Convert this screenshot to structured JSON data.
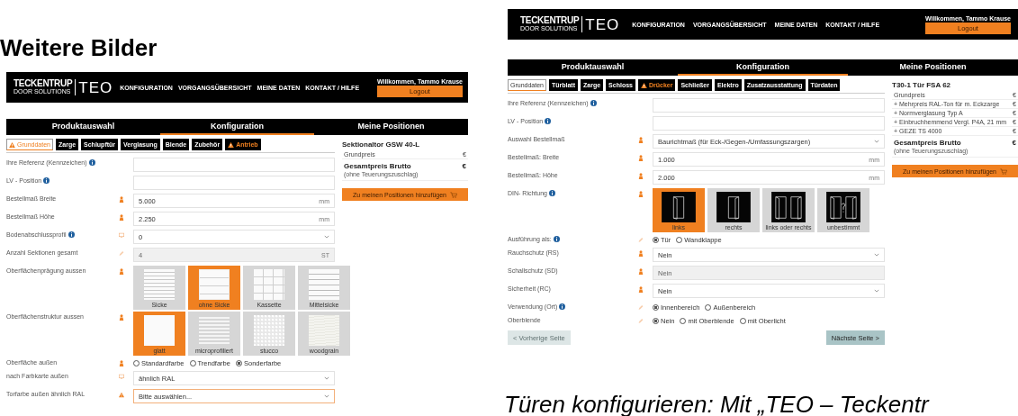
{
  "heading": "Weitere Bilder",
  "shots": [
    {
      "header": {
        "brand": "TECKENTRUP",
        "brand_sub": "DOOR SOLUTIONS",
        "product": "TEO",
        "nav": [
          "KONFIGURATION",
          "VORGANGSÜBERSICHT",
          "MEINE DATEN",
          "KONTAKT / HILFE"
        ],
        "welcome": "Willkommen, Tammo Krause",
        "logout": "Logout"
      },
      "steps": [
        {
          "label": "Produktauswahl",
          "selected": false
        },
        {
          "label": "Konfiguration",
          "selected": true
        },
        {
          "label": "Meine Positionen",
          "selected": false
        }
      ],
      "tabs": [
        {
          "label": "Grunddaten",
          "selected": true,
          "warning": true
        },
        {
          "label": "Zarge",
          "selected": false,
          "warning": false
        },
        {
          "label": "Schlupftür",
          "selected": false,
          "warning": false
        },
        {
          "label": "Verglasung",
          "selected": false,
          "warning": false
        },
        {
          "label": "Blende",
          "selected": false,
          "warning": false
        },
        {
          "label": "Zubehör",
          "selected": false,
          "warning": false
        },
        {
          "label": "Antrieb",
          "selected": false,
          "warning": true
        }
      ],
      "rows": [
        {
          "kind": "input",
          "label": "Ihre Referenz (Kennzeichen)",
          "info": true
        },
        {
          "kind": "input",
          "label": "LV - Position",
          "info": true
        },
        {
          "kind": "input",
          "label": "Bestellmaß Breite",
          "required": true,
          "value": "5.000",
          "unit": "mm"
        },
        {
          "kind": "input",
          "label": "Bestellmaß Höhe",
          "required": true,
          "value": "2.250",
          "unit": "mm"
        },
        {
          "kind": "select",
          "label": "Bodenabschlussprofil",
          "info": true,
          "screen_hint": true,
          "value": "0"
        },
        {
          "kind": "input",
          "label": "Anzahl Sektionen gesamt",
          "editable": true,
          "value": "4",
          "unit": "ST",
          "disabled": true
        },
        {
          "kind": "tiles",
          "label": "Oberflächenprägung aussen",
          "required": true,
          "tiles": [
            {
              "label": "Sicke",
              "kind": "lines",
              "selected": false
            },
            {
              "label": "ohne Sicke",
              "kind": "sections",
              "selected": true
            },
            {
              "label": "Kassette",
              "kind": "grid",
              "selected": false
            },
            {
              "label": "Mittelsicke",
              "kind": "wide",
              "selected": false
            }
          ]
        },
        {
          "kind": "tiles",
          "label": "Oberflächenstruktur aussen",
          "required": true,
          "tiles": [
            {
              "label": "glatt",
              "kind": "plain",
              "selected": true
            },
            {
              "label": "microprofiliert",
              "kind": "stripes",
              "selected": false
            },
            {
              "label": "stucco",
              "kind": "texture",
              "selected": false
            },
            {
              "label": "woodgrain",
              "kind": "wood",
              "selected": false
            }
          ]
        },
        {
          "kind": "radio",
          "label": "Oberfläche außen",
          "required": true,
          "options": [
            {
              "label": "Standardfarbe",
              "selected": false
            },
            {
              "label": "Trendfarbe",
              "selected": false
            },
            {
              "label": "Sonderfarbe",
              "selected": true
            }
          ]
        },
        {
          "kind": "select",
          "label": "nach Farbkarte außen",
          "screen_hint": true,
          "value": "ähnlich RAL"
        },
        {
          "kind": "select",
          "label": "Torfarbe außen ähnlich RAL",
          "error": true,
          "value": "Bitte auswählen...",
          "invalid": true
        }
      ],
      "panel": {
        "title": "Sektionaltor GSW 40-L",
        "lines": [
          {
            "label": "Grundpreis",
            "price": "€"
          }
        ],
        "total": "Gesamtpreis Brutto",
        "total_price": "€",
        "total_note": "(ohne Teuerungszuschlag)",
        "button": "Zu meinen Positionen hinzufügen"
      }
    },
    {
      "header": {
        "brand": "TECKENTRUP",
        "brand_sub": "DOOR SOLUTIONS",
        "product": "TEO",
        "nav": [
          "KONFIGURATION",
          "VORGANGSÜBERSICHT",
          "MEINE DATEN",
          "KONTAKT / HILFE"
        ],
        "welcome": "Willkommen, Tammo Krause",
        "logout": "Logout"
      },
      "steps": [
        {
          "label": "Produktauswahl",
          "selected": false
        },
        {
          "label": "Konfiguration",
          "selected": true
        },
        {
          "label": "Meine Positionen",
          "selected": false
        }
      ],
      "tabs": [
        {
          "label": "Grunddaten",
          "selected": true,
          "warning": false
        },
        {
          "label": "Türblatt",
          "selected": false,
          "warning": false
        },
        {
          "label": "Zarge",
          "selected": false,
          "warning": false
        },
        {
          "label": "Schloss",
          "selected": false,
          "warning": false
        },
        {
          "label": "Drücker",
          "selected": false,
          "warning": true
        },
        {
          "label": "Schließer",
          "selected": false,
          "warning": false
        },
        {
          "label": "Elektro",
          "selected": false,
          "warning": false
        },
        {
          "label": "Zusatzausstattung",
          "selected": false,
          "warning": false
        },
        {
          "label": "Türdaten",
          "selected": false,
          "warning": false
        }
      ],
      "rows": [
        {
          "kind": "input",
          "label": "Ihre Referenz (Kennzeichen)",
          "info": true
        },
        {
          "kind": "input",
          "label": "LV - Position",
          "info": true
        },
        {
          "kind": "select",
          "label": "Auswahl Bestellmaß",
          "required": true,
          "value": "Baurichtmaß (für Eck-/Gegen-/Umfassungszargen)"
        },
        {
          "kind": "input",
          "label": "Bestellmaß: Breite",
          "required": true,
          "value": "1.000",
          "unit": "mm"
        },
        {
          "kind": "input",
          "label": "Bestellmaß: Höhe",
          "required": true,
          "value": "2.000",
          "unit": "mm"
        },
        {
          "kind": "tiles",
          "label": "DIN- Richtung",
          "info": true,
          "required": true,
          "tiles": [
            {
              "label": "links",
              "kind": "door-left",
              "selected": true
            },
            {
              "label": "rechts",
              "kind": "door-right",
              "selected": false
            },
            {
              "label": "links oder rechts",
              "kind": "door-double",
              "selected": false
            },
            {
              "label": "unbestimmt",
              "kind": "door-unknown",
              "selected": false
            }
          ]
        },
        {
          "kind": "radio",
          "label": "Ausführung als:",
          "info": true,
          "editable": true,
          "options": [
            {
              "label": "Tür",
              "selected": true
            },
            {
              "label": "Wandklappe",
              "selected": false
            }
          ]
        },
        {
          "kind": "select",
          "label": "Rauchschutz (RS)",
          "required": true,
          "value": "Nein"
        },
        {
          "kind": "input",
          "label": "Schallschutz (SD)",
          "required": true,
          "value": "Nein",
          "disabled": true
        },
        {
          "kind": "select",
          "label": "Sicherheit (RC)",
          "required": true,
          "value": "Nein"
        },
        {
          "kind": "radio",
          "label": "Verwendung (Ort)",
          "info": true,
          "editable": true,
          "options": [
            {
              "label": "Innenbereich",
              "selected": true
            },
            {
              "label": "Außenbereich",
              "selected": false
            }
          ]
        },
        {
          "kind": "radio",
          "label": "Oberblende",
          "editable": true,
          "options": [
            {
              "label": "Nein",
              "selected": true
            },
            {
              "label": "mit Oberblende",
              "selected": false
            },
            {
              "label": "mit Oberlicht",
              "selected": false
            }
          ]
        }
      ],
      "panel": {
        "title": "T30-1 Tür FSA 62",
        "lines": [
          {
            "label": "Grundpreis",
            "price": "€"
          },
          {
            "label": "+ Mehrpreis RAL-Ton für m. Eckzarge",
            "price": "€"
          },
          {
            "label": "+ Normverglasung Typ A",
            "price": "€"
          },
          {
            "label": "+ Einbruchhemmend Vergl. P4A, 21 mm",
            "price": "€"
          },
          {
            "label": "+ GEZE TS 4000",
            "price": "€"
          }
        ],
        "total": "Gesamtpreis Brutto",
        "total_price": "€",
        "total_note": "(ohne Teuerungszuschlag)",
        "button": "Zu meinen Positionen hinzufügen"
      },
      "footer": {
        "prev": "< Vorherige Seite",
        "next": "Nächste Seite >"
      }
    }
  ],
  "caption": "Türen konfigurieren: Mit „TEO – Teckentr"
}
